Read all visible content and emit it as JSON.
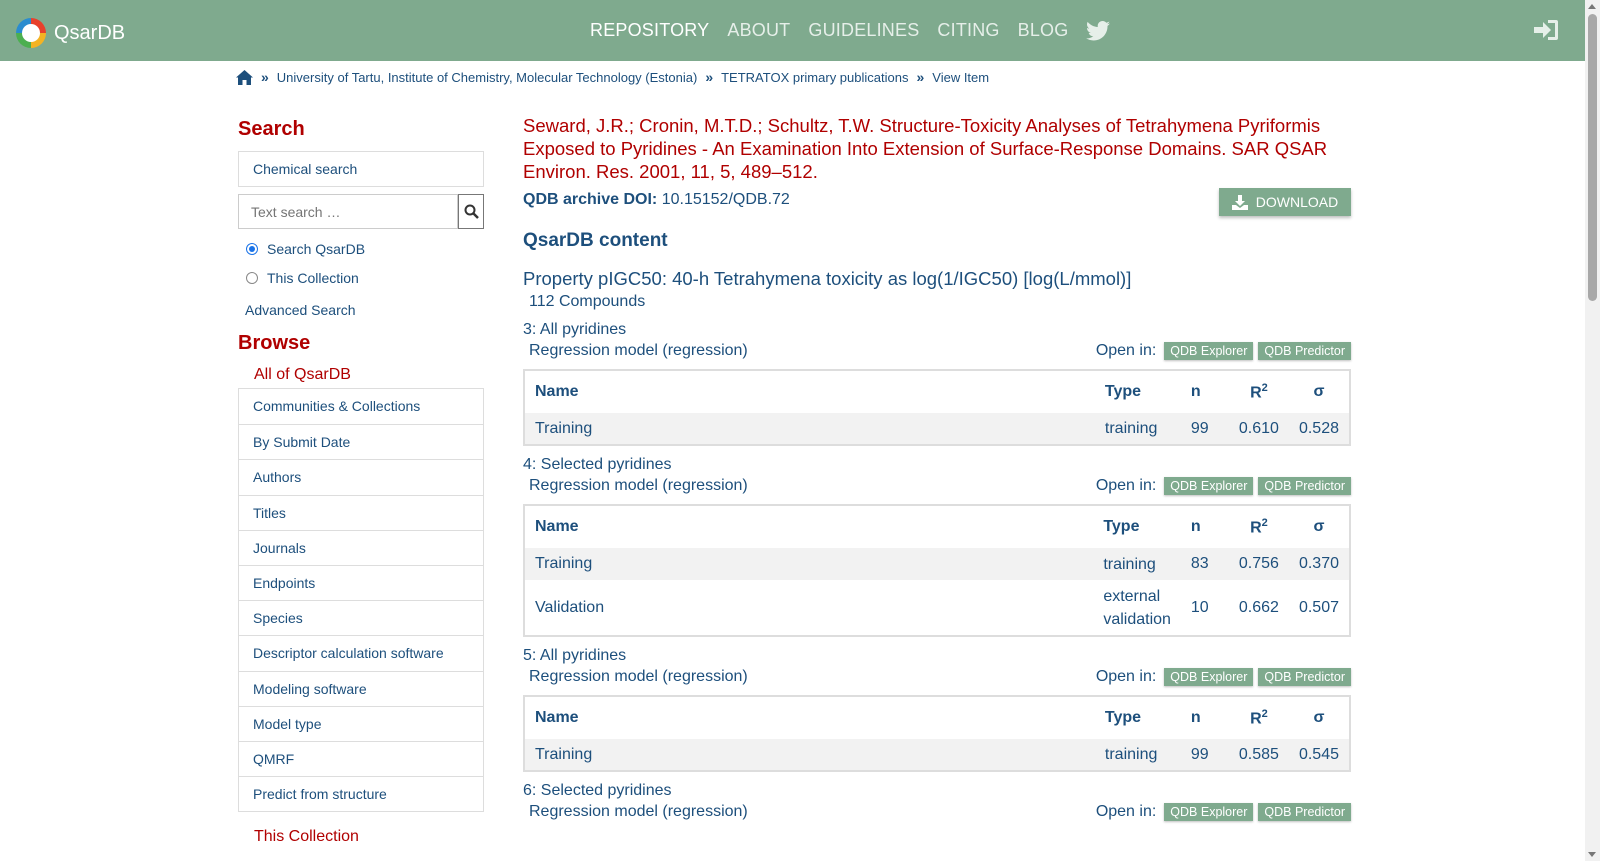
{
  "navbar": {
    "brand": "QsarDB",
    "links": [
      "REPOSITORY",
      "ABOUT",
      "GUIDELINES",
      "CITING",
      "BLOG"
    ],
    "colors": {
      "bar": "#7faa8e",
      "accent": "#b00000",
      "link": "#1d4f7c"
    }
  },
  "breadcrumb": {
    "items": [
      "University of Tartu, Institute of Chemistry, Molecular Technology (Estonia)",
      "TETRATOX primary publications",
      "View Item"
    ]
  },
  "sidebar": {
    "search_heading": "Search",
    "chemical_search": "Chemical search",
    "text_search_placeholder": "Text search …",
    "radio_qsardb": "Search QsarDB",
    "radio_collection": "This Collection",
    "advanced": "Advanced Search",
    "browse_heading": "Browse",
    "all_of": "All of QsarDB",
    "items": [
      "Communities & Collections",
      "By Submit Date",
      "Authors",
      "Titles",
      "Journals",
      "Endpoints",
      "Species",
      "Descriptor calculation software",
      "Modeling software",
      "Model type",
      "QMRF",
      "Predict from structure"
    ],
    "this_collection": "This Collection"
  },
  "main": {
    "citation": "Seward, J.R.; Cronin, M.T.D.; Schultz, T.W. Structure-Toxicity Analyses of Tetrahymena Pyriformis Exposed to Pyridines - An Examination Into Extension of Surface-Response Domains. SAR QSAR Environ. Res. 2001, 11, 5, 489–512.",
    "doi_label": "QDB archive DOI:",
    "doi_value": "10.15152/QDB.72",
    "download": "DOWNLOAD",
    "content_heading": "QsarDB content",
    "property": "Property pIGC50: 40-h Tetrahymena toxicity as log(1/IGC50) [log(L/mmol)]",
    "compounds": "112 Compounds",
    "open_in": "Open in:",
    "explorer": "QDB Explorer",
    "predictor": "QDB Predictor",
    "headers": {
      "name": "Name",
      "type": "Type",
      "n": "n",
      "r": "R",
      "r_sup": "2",
      "sigma": "σ"
    },
    "models": [
      {
        "title": "3: All pyridines",
        "sub": "Regression model (regression)",
        "rows": [
          {
            "name": "Training",
            "type": "training",
            "n": "99",
            "r2": "0.610",
            "sigma": "0.528"
          }
        ]
      },
      {
        "title": "4: Selected pyridines",
        "sub": "Regression model (regression)",
        "rows": [
          {
            "name": "Training",
            "type": "training",
            "n": "83",
            "r2": "0.756",
            "sigma": "0.370"
          },
          {
            "name": "Validation",
            "type": "external validation",
            "n": "10",
            "r2": "0.662",
            "sigma": "0.507"
          }
        ]
      },
      {
        "title": "5: All pyridines",
        "sub": "Regression model (regression)",
        "rows": [
          {
            "name": "Training",
            "type": "training",
            "n": "99",
            "r2": "0.585",
            "sigma": "0.545"
          }
        ]
      },
      {
        "title": "6: Selected pyridines",
        "sub": "Regression model (regression)",
        "rows": []
      }
    ]
  }
}
